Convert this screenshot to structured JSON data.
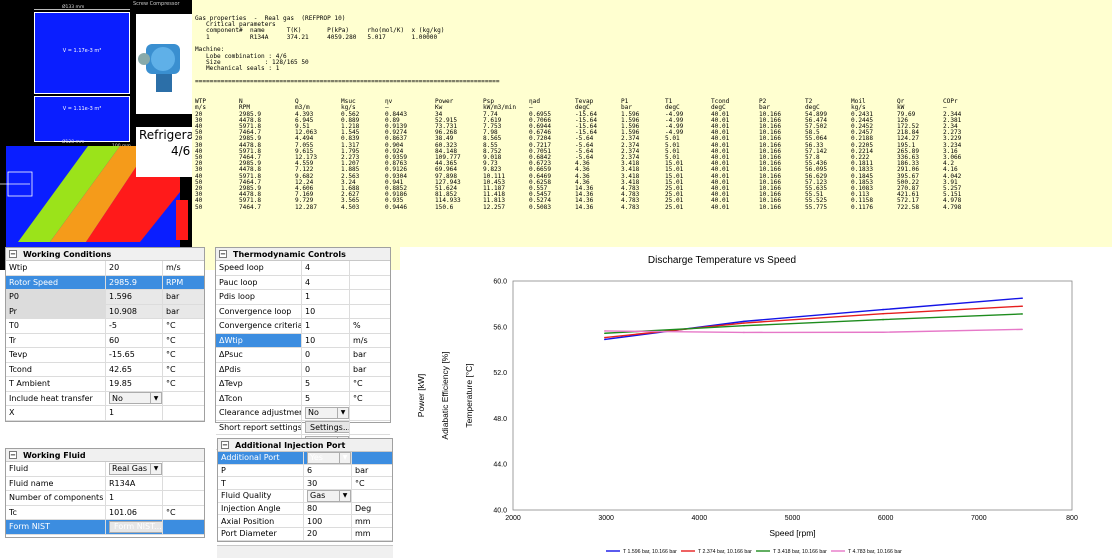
{
  "model_view": {
    "title": "Screw Compressor",
    "rotor_top_dim": "Ø133 mm",
    "rotor_top_volume": "V = 1.17e-3 m³",
    "rotor_mid_volume": "V = 1.11e-3 m³",
    "rotor_mid_dim": "Ø128 mm",
    "side_dim": "100 mm",
    "bottom_dim": "64 mm",
    "overlay_line1": "Refrigera",
    "overlay_line2": "4/6"
  },
  "report": {
    "header": "Gas properties  -  Real gas  (REFPROP 10)\n   Critical parameters\n   component#  name      T(K)       P(kPa)     rho(mol/K)  x (kg/kg)\n   1           R134A     374.21     4059.280   5.017       1.00000\n\nMachine:\n   Lobe combination : 4/6\n   Size            : 128/165 50\n   Mechanical seals : 1\n\n===================================================================================",
    "columns": [
      [
        "WTP",
        "m/s"
      ],
      [
        "N",
        "RPM"
      ],
      [
        "Q",
        "m3/m"
      ],
      [
        "Msuc",
        "kg/s"
      ],
      [
        "ηv",
        "–"
      ],
      [
        "Power",
        "Kw"
      ],
      [
        "Psp",
        "kW/m3/min"
      ],
      [
        "ηad",
        "–"
      ],
      [
        "Tevap",
        "degC"
      ],
      [
        "P1",
        "bar"
      ],
      [
        "T1",
        "degC"
      ],
      [
        "Tcond",
        "degC"
      ],
      [
        "P2",
        "bar"
      ],
      [
        "T2",
        "degC"
      ],
      [
        "Moil",
        "kg/s"
      ],
      [
        "Qr",
        "kW"
      ],
      [
        "COPr",
        "–"
      ]
    ],
    "rows": [
      [
        "20",
        "2985.9",
        "4.393",
        "0.562",
        "0.8443",
        "34",
        "7.74",
        "0.6955",
        "-15.64",
        "1.596",
        "-4.99",
        "40.01",
        "10.166",
        "54.899",
        "0.2431",
        "79.69",
        "2.344"
      ],
      [
        "30",
        "4478.8",
        "6.945",
        "0.889",
        "0.89",
        "52.915",
        "7.619",
        "0.7066",
        "-15.64",
        "1.596",
        "-4.99",
        "40.01",
        "10.166",
        "56.474",
        "0.2445",
        "126",
        "2.381"
      ],
      [
        "40",
        "5971.8",
        "9.51",
        "1.218",
        "0.9139",
        "73.731",
        "7.753",
        "0.6944",
        "-15.64",
        "1.596",
        "-4.99",
        "40.01",
        "10.166",
        "57.502",
        "0.2452",
        "172.52",
        "2.34"
      ],
      [
        "50",
        "7464.7",
        "12.063",
        "1.545",
        "0.9274",
        "96.268",
        "7.98",
        "0.6746",
        "-15.64",
        "1.596",
        "-4.99",
        "40.01",
        "10.166",
        "58.5",
        "0.2457",
        "218.84",
        "2.273"
      ],
      [
        "20",
        "2985.9",
        "4.494",
        "0.839",
        "0.8637",
        "38.49",
        "8.565",
        "0.7204",
        "-5.64",
        "2.374",
        "5.01",
        "40.01",
        "10.166",
        "55.064",
        "0.2188",
        "124.27",
        "3.229"
      ],
      [
        "30",
        "4478.8",
        "7.055",
        "1.317",
        "0.904",
        "60.323",
        "8.55",
        "0.7217",
        "-5.64",
        "2.374",
        "5.01",
        "40.01",
        "10.166",
        "56.33",
        "0.2205",
        "195.1",
        "3.234"
      ],
      [
        "40",
        "5971.8",
        "9.615",
        "1.795",
        "0.924",
        "84.148",
        "8.752",
        "0.7051",
        "-5.64",
        "2.374",
        "5.01",
        "40.01",
        "10.166",
        "57.142",
        "0.2214",
        "265.89",
        "3.16"
      ],
      [
        "50",
        "7464.7",
        "12.173",
        "2.273",
        "0.9359",
        "109.777",
        "9.018",
        "0.6842",
        "-5.64",
        "2.374",
        "5.01",
        "40.01",
        "10.166",
        "57.8",
        "0.222",
        "336.63",
        "3.066"
      ],
      [
        "20",
        "2985.9",
        "4.559",
        "1.207",
        "0.8763",
        "44.365",
        "9.73",
        "0.6723",
        "4.36",
        "3.418",
        "15.01",
        "40.01",
        "10.166",
        "55.436",
        "0.1811",
        "186.33",
        "4.2"
      ],
      [
        "30",
        "4478.8",
        "7.122",
        "1.885",
        "0.9126",
        "69.964",
        "9.823",
        "0.6659",
        "4.36",
        "3.418",
        "15.01",
        "40.01",
        "10.166",
        "56.095",
        "0.1833",
        "291.06",
        "4.16"
      ],
      [
        "40",
        "5971.8",
        "9.682",
        "2.563",
        "0.9304",
        "97.898",
        "10.111",
        "0.6469",
        "4.36",
        "3.418",
        "15.01",
        "40.01",
        "10.166",
        "56.629",
        "0.1845",
        "395.67",
        "4.042"
      ],
      [
        "50",
        "7464.7",
        "12.24",
        "3.24",
        "0.941",
        "127.943",
        "10.453",
        "0.6258",
        "4.36",
        "3.418",
        "15.01",
        "40.01",
        "10.166",
        "57.123",
        "0.1853",
        "500.22",
        "3.91"
      ],
      [
        "20",
        "2985.9",
        "4.606",
        "1.688",
        "0.8852",
        "51.624",
        "11.187",
        "0.557",
        "14.36",
        "4.783",
        "25.01",
        "40.01",
        "10.166",
        "55.635",
        "0.1083",
        "270.87",
        "5.257"
      ],
      [
        "30",
        "4478.8",
        "7.169",
        "2.627",
        "0.9186",
        "81.852",
        "11.418",
        "0.5457",
        "14.36",
        "4.783",
        "25.01",
        "40.01",
        "10.166",
        "55.51",
        "0.113",
        "421.61",
        "5.151"
      ],
      [
        "40",
        "5971.8",
        "9.729",
        "3.565",
        "0.935",
        "114.933",
        "11.813",
        "0.5274",
        "14.36",
        "4.783",
        "25.01",
        "40.01",
        "10.166",
        "55.525",
        "0.1158",
        "572.17",
        "4.978"
      ],
      [
        "50",
        "7464.7",
        "12.287",
        "4.503",
        "0.9446",
        "150.6",
        "12.257",
        "0.5083",
        "14.36",
        "4.783",
        "25.01",
        "40.01",
        "10.166",
        "55.775",
        "0.1176",
        "722.58",
        "4.798"
      ]
    ]
  },
  "working_conditions": {
    "title": "Working Conditions",
    "rows": [
      {
        "label": "Wtip",
        "value": "20",
        "unit": "m/s"
      },
      {
        "label": "Rotor Speed",
        "value": "2985.9",
        "unit": "RPM"
      },
      {
        "label": "P0",
        "value": "1.596",
        "unit": "bar"
      },
      {
        "label": "Pr",
        "value": "10.908",
        "unit": "bar"
      },
      {
        "label": "T0",
        "value": "-5",
        "unit": "°C"
      },
      {
        "label": "Tr",
        "value": "60",
        "unit": "°C"
      },
      {
        "label": "Tevp",
        "value": "-15.65",
        "unit": "°C"
      },
      {
        "label": "Tcond",
        "value": "42.65",
        "unit": "°C"
      },
      {
        "label": "T Ambient",
        "value": "19.85",
        "unit": "°C"
      },
      {
        "label": "Include heat transfer",
        "value": "No",
        "unit": ""
      },
      {
        "label": "X",
        "value": "1",
        "unit": ""
      }
    ]
  },
  "working_fluid": {
    "title": "Working Fluid",
    "rows": [
      {
        "label": "Fluid",
        "value": "Real Gas",
        "unit": ""
      },
      {
        "label": "Fluid name",
        "value": "R134A",
        "unit": ""
      },
      {
        "label": "Number of components",
        "value": "1",
        "unit": ""
      },
      {
        "label": "Tc",
        "value": "101.06",
        "unit": "°C"
      },
      {
        "label": "Form NIST",
        "value": "Form NIST...",
        "unit": ""
      }
    ]
  },
  "thermo_controls": {
    "title": "Thermodynamic Controls",
    "rows": [
      {
        "label": "Speed loop",
        "value": "4",
        "unit": ""
      },
      {
        "label": "Pauc loop",
        "value": "4",
        "unit": ""
      },
      {
        "label": "Pdis loop",
        "value": "1",
        "unit": ""
      },
      {
        "label": "Convergence loop",
        "value": "10",
        "unit": ""
      },
      {
        "label": "Convergence criteria",
        "value": "1",
        "unit": "%"
      },
      {
        "label": "ΔWtip",
        "value": "10",
        "unit": "m/s"
      },
      {
        "label": "ΔPsuc",
        "value": "0",
        "unit": "bar"
      },
      {
        "label": "ΔPdis",
        "value": "0",
        "unit": "bar"
      },
      {
        "label": "ΔTevp",
        "value": "5",
        "unit": "°C"
      },
      {
        "label": "ΔTcon",
        "value": "5",
        "unit": "°C"
      },
      {
        "label": "Clearance adjustment",
        "value": "No",
        "unit": ""
      },
      {
        "label": "Short report settings",
        "value": "Settings...",
        "unit": ""
      },
      {
        "label": "Thermodynamic solver",
        "value": "SCORG",
        "unit": ""
      }
    ]
  },
  "injection_port": {
    "title": "Additional Injection Port",
    "rows": [
      {
        "label": "Additional Port",
        "value": "Yes",
        "unit": ""
      },
      {
        "label": "P",
        "value": "6",
        "unit": "bar"
      },
      {
        "label": "T",
        "value": "30",
        "unit": "°C"
      },
      {
        "label": "Fluid Quality",
        "value": "Gas",
        "unit": ""
      },
      {
        "label": "Injection Angle",
        "value": "80",
        "unit": "Deg"
      },
      {
        "label": "Axial Position",
        "value": "100",
        "unit": "mm"
      },
      {
        "label": "Port Diameter",
        "value": "20",
        "unit": "mm"
      }
    ]
  },
  "chart_data": {
    "type": "line",
    "title": "Discharge Temperature vs Speed",
    "xlabel": "Speed [rpm]",
    "ylabels": [
      "Power [kW]",
      "Adiabatic Efficiency [%]",
      "Temperature [°C]"
    ],
    "xlim": [
      2000,
      8000
    ],
    "ylim": [
      40,
      60
    ],
    "xticks": [
      "2000",
      "3000",
      "4000",
      "5000",
      "6000",
      "7000",
      "800"
    ],
    "yticks": [
      "40.0",
      "44.0",
      "48.0",
      "52.0",
      "56.0",
      "60.0"
    ],
    "grid": true,
    "legend_placement": "bottom",
    "series": [
      {
        "name": "T 1.596 bar, 10.166 bar",
        "color": "#1414e6",
        "x": [
          2985.9,
          4478.8,
          5971.8,
          7464.7
        ],
        "y": [
          54.899,
          56.474,
          57.502,
          58.5
        ]
      },
      {
        "name": "T 2.374 bar, 10.166 bar",
        "color": "#e61e1e",
        "x": [
          2985.9,
          4478.8,
          5971.8,
          7464.7
        ],
        "y": [
          55.064,
          56.33,
          57.142,
          57.8
        ]
      },
      {
        "name": "T 3.418 bar, 10.166 bar",
        "color": "#1e8c1e",
        "x": [
          2985.9,
          4478.8,
          5971.8,
          7464.7
        ],
        "y": [
          55.436,
          56.095,
          56.629,
          57.123
        ]
      },
      {
        "name": "T 4.783 bar, 10.166 bar",
        "color": "#e678c8",
        "x": [
          2985.9,
          4478.8,
          5971.8,
          7464.7
        ],
        "y": [
          55.635,
          55.51,
          55.525,
          55.775
        ]
      }
    ]
  }
}
